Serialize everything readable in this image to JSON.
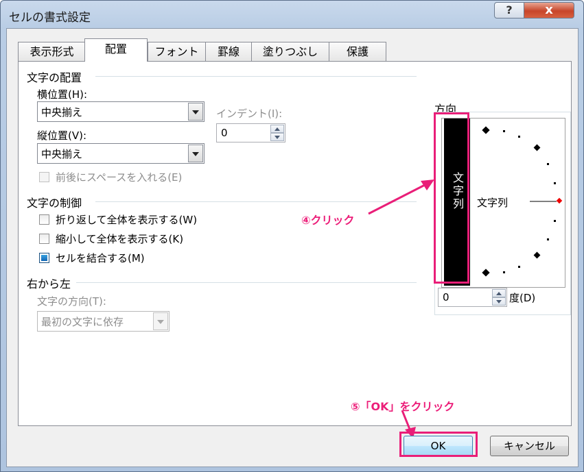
{
  "window": {
    "title": "セルの書式設定",
    "help_label": "?",
    "close_label": "x"
  },
  "tabs": [
    "表示形式",
    "配置",
    "フォント",
    "罫線",
    "塗りつぶし",
    "保護"
  ],
  "alignment": {
    "group_label": "文字の配置",
    "horizontal_label": "横位置(H):",
    "horizontal_value": "中央揃え",
    "vertical_label": "縦位置(V):",
    "vertical_value": "中央揃え",
    "indent_label": "インデント(I):",
    "indent_value": "0",
    "distributed_label": "前後にスペースを入れる(E)"
  },
  "text_control": {
    "group_label": "文字の制御",
    "wrap_label": "折り返して全体を表示する(W)",
    "shrink_label": "縮小して全体を表示する(K)",
    "merge_label": "セルを結合する(M)",
    "merge_checked": true
  },
  "rtl": {
    "group_label": "右から左",
    "direction_label": "文字の方向(T):",
    "direction_value": "最初の文字に依存"
  },
  "orientation": {
    "group_label": "方向",
    "vertical_text": "文字列",
    "dial_text": "文字列",
    "degree_value": "0",
    "degree_label": "度(D)"
  },
  "annotations": {
    "step4": "④クリック",
    "step5": "⑤「OK」をクリック"
  },
  "buttons": {
    "ok": "OK",
    "cancel": "キャンセル"
  },
  "colors": {
    "annotation": "#e91e78",
    "ok_button": "#bee6fd"
  }
}
